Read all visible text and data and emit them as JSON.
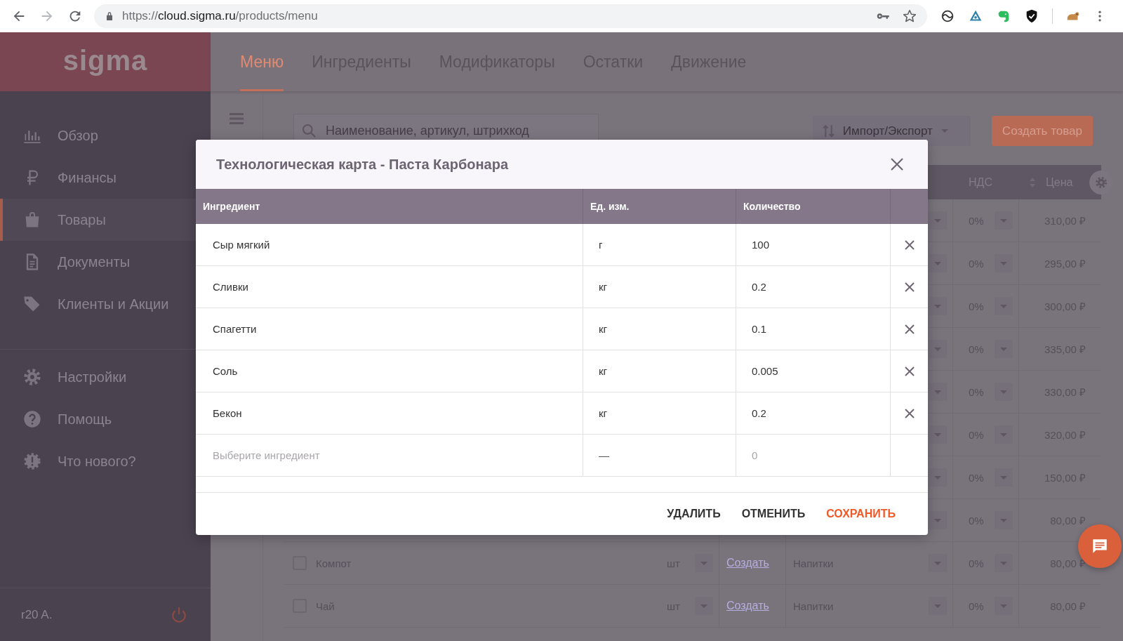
{
  "browser": {
    "url": {
      "scheme": "https://",
      "host": "cloud.sigma.ru",
      "path": "/products/menu"
    }
  },
  "sidebar": {
    "logo": "sigma",
    "main_items": [
      {
        "label": "Обзор",
        "selected": false
      },
      {
        "label": "Финансы",
        "selected": false
      },
      {
        "label": "Товары",
        "selected": true
      },
      {
        "label": "Документы",
        "selected": false
      },
      {
        "label": "Клиенты и Акции",
        "selected": false
      }
    ],
    "extra_items": [
      {
        "label": "Настройки",
        "selected": false
      },
      {
        "label": "Помощь",
        "selected": false
      },
      {
        "label": "Что нового?",
        "selected": false
      }
    ],
    "user": "r20 A."
  },
  "nav_tabs": [
    {
      "label": "Меню",
      "selected": true
    },
    {
      "label": "Ингредиенты",
      "selected": false
    },
    {
      "label": "Модификаторы",
      "selected": false
    },
    {
      "label": "Остатки",
      "selected": false
    },
    {
      "label": "Движение",
      "selected": false
    }
  ],
  "toolbar": {
    "search_placeholder": "Наименование, артикул, штрихкод",
    "import_export": "Импорт/Экспорт",
    "create_button": "Создать товар"
  },
  "products_table": {
    "columns": {
      "vat": "НДС",
      "price": "Цена"
    },
    "rows": [
      {
        "vat": "0%",
        "price": "310,00 ₽"
      },
      {
        "vat": "0%",
        "price": "295,00 ₽"
      },
      {
        "vat": "0%",
        "price": "300,00 ₽"
      },
      {
        "vat": "0%",
        "price": "335,00 ₽"
      },
      {
        "vat": "0%",
        "price": "330,00 ₽"
      },
      {
        "vat": "0%",
        "price": "320,00 ₽"
      },
      {
        "vat": "0%",
        "price": "150,00 ₽"
      },
      {
        "vat": "0%",
        "price": "80,00 ₽"
      },
      {
        "checked": false,
        "name": "Компот",
        "unit": "шт",
        "recipe_link": "Создать",
        "category": "Напитки",
        "vat": "0%",
        "price": "80,00 ₽"
      },
      {
        "checked": false,
        "name": "Чай",
        "unit": "шт",
        "recipe_link": "Создать",
        "category": "Напитки",
        "vat": "0%",
        "price": "80,00 ₽"
      }
    ]
  },
  "modal": {
    "title": "Технологическая карта - Паста Карбонара",
    "columns": [
      "Ингредиент",
      "Ед. изм.",
      "Количество"
    ],
    "rows": [
      {
        "ingredient": "Сыр мягкий",
        "unit": "г",
        "quantity": "100"
      },
      {
        "ingredient": "Сливки",
        "unit": "кг",
        "quantity": "0.2"
      },
      {
        "ingredient": "Спагетти",
        "unit": "кг",
        "quantity": "0.1"
      },
      {
        "ingredient": "Соль",
        "unit": "кг",
        "quantity": "0.005"
      },
      {
        "ingredient": "Бекон",
        "unit": "кг",
        "quantity": "0.2"
      }
    ],
    "new_row": {
      "placeholder": "Выберите ингредиент",
      "unit": "—",
      "quantity": "0"
    },
    "buttons": [
      {
        "label": "УДАЛИТЬ",
        "kind": "plain"
      },
      {
        "label": "ОТМЕНИТЬ",
        "kind": "plain"
      },
      {
        "label": "СОХРАНИТЬ",
        "kind": "primary"
      }
    ]
  }
}
